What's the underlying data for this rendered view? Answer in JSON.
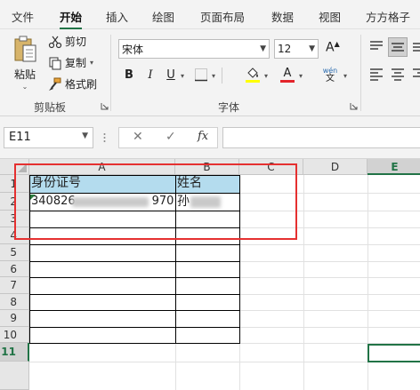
{
  "menu": {
    "tabs": [
      "文件",
      "开始",
      "插入",
      "绘图",
      "页面布局",
      "数据",
      "视图",
      "方方格子"
    ],
    "active_tab": "开始"
  },
  "clipboard": {
    "paste_label": "粘贴",
    "cut_label": "剪切",
    "copy_label": "复制",
    "format_painter_label": "格式刷",
    "group_label": "剪贴板"
  },
  "font": {
    "name": "宋体",
    "size": "12",
    "bold": "B",
    "italic": "I",
    "underline": "U",
    "font_color_glyph": "A",
    "phonetic_glyph": "wén",
    "phonetic_glyph_sub": "文",
    "group_label": "字体"
  },
  "colors": {
    "accent": "#217346",
    "fill_yellow": "#ffff00",
    "font_red": "#e3242b",
    "header_fill": "#b4dcee",
    "annotation_red": "#e53030"
  },
  "formula_bar": {
    "name_box": "E11",
    "cancel_glyph": "✕",
    "enter_glyph": "✓",
    "fx_glyph": "fx",
    "formula": ""
  },
  "sheet": {
    "columns": [
      "A",
      "B",
      "C",
      "D",
      "E"
    ],
    "selected_column": "E",
    "rows": [
      "1",
      "2",
      "3",
      "4",
      "5",
      "6",
      "7",
      "8",
      "9",
      "10",
      "11"
    ],
    "selected_row": "11",
    "a1": "身份证号",
    "b1": "姓名",
    "a2_prefix": "340826",
    "a2_suffix": "970",
    "b2_prefix": "孙"
  }
}
